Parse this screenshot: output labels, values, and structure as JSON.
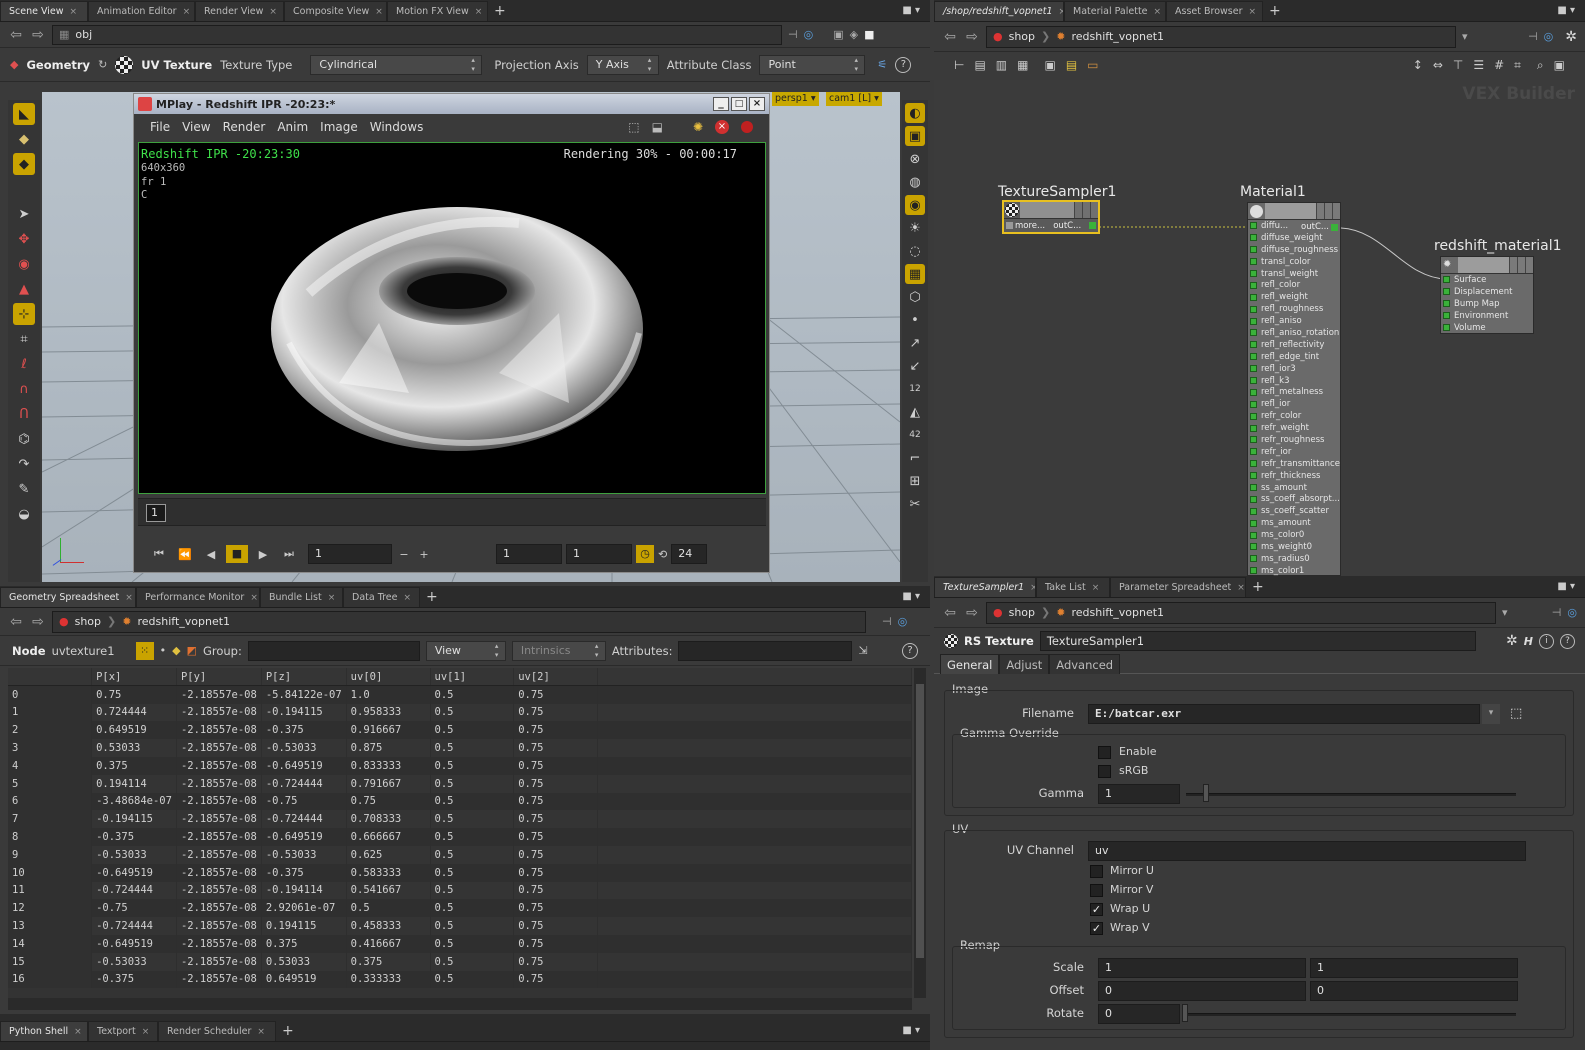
{
  "scene": {
    "tabs": [
      {
        "label": "Scene View",
        "active": true
      },
      {
        "label": "Animation Editor"
      },
      {
        "label": "Render View"
      },
      {
        "label": "Composite View"
      },
      {
        "label": "Motion FX View"
      }
    ],
    "path": "obj",
    "toolbar": {
      "context": "Geometry",
      "node_type": "UV Texture",
      "texture_type_label": "Texture Type",
      "texture_type_value": "Cylindrical",
      "projection_axis_label": "Projection Axis",
      "projection_axis_value": "Y Axis",
      "attribute_class_label": "Attribute Class",
      "attribute_class_value": "Point"
    },
    "viewport": {
      "camera": "persp1",
      "cam": "cam1 [L]"
    }
  },
  "mplay": {
    "title": "MPlay - Redshift IPR -20:23:*",
    "menu": [
      "File",
      "View",
      "Render",
      "Anim",
      "Image",
      "Windows"
    ],
    "overlay": {
      "line1": "Redshift IPR -20:23:30",
      "line2": "640x360",
      "line3": "fr 1",
      "line4": "C",
      "status": "Rendering 30% - 00:00:17"
    },
    "timeline_frame": "1",
    "frame_field": "1",
    "range_start": "1",
    "range_end": "1",
    "fps": "24"
  },
  "network": {
    "tabs": [
      {
        "label": "/shop/redshift_vopnet1",
        "active": true
      },
      {
        "label": "Material Palette"
      },
      {
        "label": "Asset Browser"
      }
    ],
    "crumbs": [
      "shop",
      "redshift_vopnet1"
    ],
    "watermark": "VEX Builder",
    "nodes": {
      "texture_sampler": {
        "name": "TextureSampler1",
        "ports": "more...   outC..."
      },
      "material": {
        "name": "Material1",
        "out_port": "outC...",
        "inputs": [
          "diffu...",
          "diffuse_weight",
          "diffuse_roughness",
          "transl_color",
          "transl_weight",
          "refl_color",
          "refl_weight",
          "refl_roughness",
          "refl_aniso",
          "refl_aniso_rotation",
          "refl_reflectivity",
          "refl_edge_tint",
          "refl_ior3",
          "refl_k3",
          "refl_metalness",
          "refl_ior",
          "refr_color",
          "refr_weight",
          "refr_roughness",
          "refr_ior",
          "refr_transmittance",
          "refr_thickness",
          "ss_amount",
          "ss_coeff_absorpt...",
          "ss_coeff_scatter",
          "ms_amount",
          "ms_color0",
          "ms_weight0",
          "ms_radius0",
          "ms_color1"
        ]
      },
      "output": {
        "name": "redshift_material1",
        "inputs": [
          "Surface",
          "Displacement",
          "Bump Map",
          "Environment",
          "Volume"
        ]
      }
    }
  },
  "spreadsheet": {
    "tabs": [
      {
        "label": "Geometry Spreadsheet",
        "active": true
      },
      {
        "label": "Performance Monitor"
      },
      {
        "label": "Bundle List"
      },
      {
        "label": "Data Tree"
      }
    ],
    "crumbs": [
      "shop",
      "redshift_vopnet1"
    ],
    "node_label": "Node",
    "node_value": "uvtexture1",
    "group_label": "Group:",
    "view_value": "View",
    "intrinsics_value": "Intrinsics",
    "attributes_label": "Attributes:",
    "columns": [
      "",
      "P[x]",
      "P[y]",
      "P[z]",
      "uv[0]",
      "uv[1]",
      "uv[2]"
    ],
    "rows": [
      [
        "0",
        "0.75",
        "-2.18557e-08",
        "-5.84122e-07",
        "1.0",
        "0.5",
        "0.75"
      ],
      [
        "1",
        "0.724444",
        "-2.18557e-08",
        "-0.194115",
        "0.958333",
        "0.5",
        "0.75"
      ],
      [
        "2",
        "0.649519",
        "-2.18557e-08",
        "-0.375",
        "0.916667",
        "0.5",
        "0.75"
      ],
      [
        "3",
        "0.53033",
        "-2.18557e-08",
        "-0.53033",
        "0.875",
        "0.5",
        "0.75"
      ],
      [
        "4",
        "0.375",
        "-2.18557e-08",
        "-0.649519",
        "0.833333",
        "0.5",
        "0.75"
      ],
      [
        "5",
        "0.194114",
        "-2.18557e-08",
        "-0.724444",
        "0.791667",
        "0.5",
        "0.75"
      ],
      [
        "6",
        "-3.48684e-07",
        "-2.18557e-08",
        "-0.75",
        "0.75",
        "0.5",
        "0.75"
      ],
      [
        "7",
        "-0.194115",
        "-2.18557e-08",
        "-0.724444",
        "0.708333",
        "0.5",
        "0.75"
      ],
      [
        "8",
        "-0.375",
        "-2.18557e-08",
        "-0.649519",
        "0.666667",
        "0.5",
        "0.75"
      ],
      [
        "9",
        "-0.53033",
        "-2.18557e-08",
        "-0.53033",
        "0.625",
        "0.5",
        "0.75"
      ],
      [
        "10",
        "-0.649519",
        "-2.18557e-08",
        "-0.375",
        "0.583333",
        "0.5",
        "0.75"
      ],
      [
        "11",
        "-0.724444",
        "-2.18557e-08",
        "-0.194114",
        "0.541667",
        "0.5",
        "0.75"
      ],
      [
        "12",
        "-0.75",
        "-2.18557e-08",
        "2.92061e-07",
        "0.5",
        "0.5",
        "0.75"
      ],
      [
        "13",
        "-0.724444",
        "-2.18557e-08",
        "0.194115",
        "0.458333",
        "0.5",
        "0.75"
      ],
      [
        "14",
        "-0.649519",
        "-2.18557e-08",
        "0.375",
        "0.416667",
        "0.5",
        "0.75"
      ],
      [
        "15",
        "-0.53033",
        "-2.18557e-08",
        "0.53033",
        "0.375",
        "0.5",
        "0.75"
      ],
      [
        "16",
        "-0.375",
        "-2.18557e-08",
        "0.649519",
        "0.333333",
        "0.5",
        "0.75"
      ]
    ]
  },
  "params": {
    "tabs": [
      {
        "label": "TextureSampler1",
        "active": true
      },
      {
        "label": "Take List"
      },
      {
        "label": "Parameter Spreadsheet"
      }
    ],
    "crumbs": [
      "shop",
      "redshift_vopnet1"
    ],
    "node_type": "RS Texture",
    "node_name": "TextureSampler1",
    "subtabs": [
      {
        "label": "General",
        "active": true
      },
      {
        "label": "Adjust"
      },
      {
        "label": "Advanced"
      }
    ],
    "image_section": "Image",
    "filename_label": "Filename",
    "filename_value": "E:/batcar.exr",
    "gamma_override_section": "Gamma Override",
    "enable_label": "Enable",
    "srgb_label": "sRGB",
    "gamma_label": "Gamma",
    "gamma_value": "1",
    "uv_section": "UV",
    "uv_channel_label": "UV Channel",
    "uv_channel_value": "uv",
    "mirror_u_label": "Mirror U",
    "mirror_v_label": "Mirror V",
    "wrap_u_label": "Wrap U",
    "wrap_v_label": "Wrap V",
    "check_mark": "✓",
    "remap_section": "Remap",
    "scale_label": "Scale",
    "scale_values": [
      "1",
      "1"
    ],
    "offset_label": "Offset",
    "offset_values": [
      "0",
      "0"
    ],
    "rotate_label": "Rotate",
    "rotate_value": "0"
  },
  "bottom_tabs": [
    {
      "label": "Python Shell",
      "active": true
    },
    {
      "label": "Textport"
    },
    {
      "label": "Render Scheduler"
    }
  ],
  "colors": {
    "accent_yellow": "#e8c020",
    "port_green": "#3ab23a",
    "ipr_green": "#3fe04a",
    "link": "#c8c8c8"
  }
}
